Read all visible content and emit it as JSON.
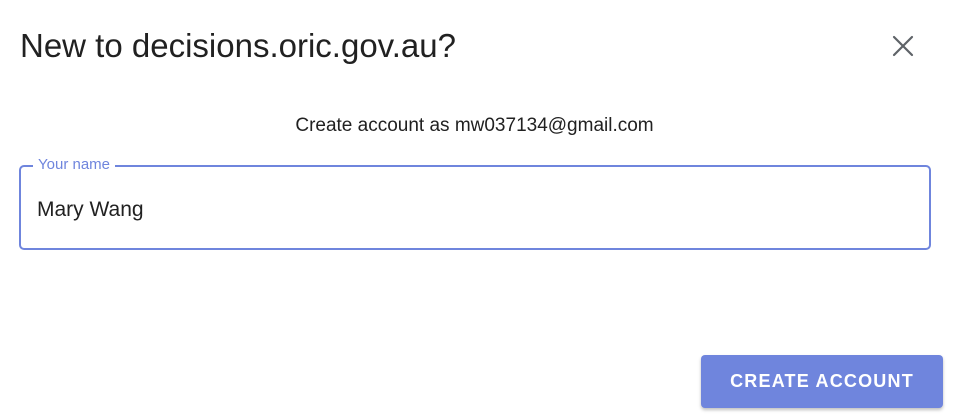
{
  "dialog": {
    "title": "New to decisions.oric.gov.au?",
    "close_icon": "close-icon",
    "subtitle": "Create account as mw037134@gmail.com",
    "name_field": {
      "label": "Your name",
      "value": "Mary Wang"
    },
    "create_button_label": "CREATE ACCOUNT"
  },
  "colors": {
    "accent": "#6f85dd",
    "text": "#212121",
    "icon": "#5f6368"
  }
}
